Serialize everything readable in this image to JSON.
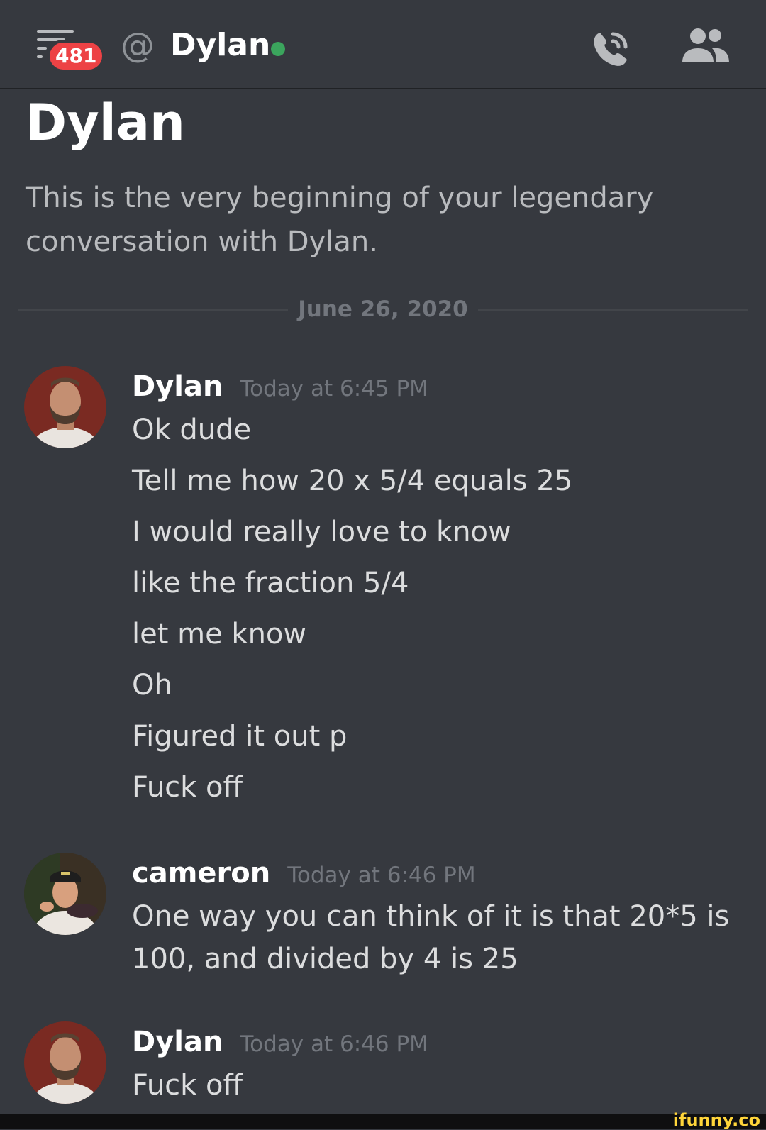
{
  "header": {
    "unread_count": "481",
    "title": "Dylan",
    "menu_icon": "hamburger-icon",
    "at_icon": "at-icon",
    "call_icon": "phone-call-icon",
    "members_icon": "members-icon",
    "status_color": "#3ba55d"
  },
  "welcome": {
    "title": "Dylan",
    "text": "This is the very beginning of your legendary conversation with Dylan."
  },
  "date_divider": "June 26, 2020",
  "messages": [
    {
      "author": "Dylan",
      "timestamp": "Today at 6:45 PM",
      "lines": [
        "Ok dude",
        "Tell me how 20 x 5/4 equals 25",
        "I would really love to know",
        "like the fraction 5/4",
        "let me know",
        "Oh",
        "Figured it out p",
        "Fuck off"
      ]
    },
    {
      "author": "cameron",
      "timestamp": "Today at 6:46 PM",
      "text": "One way you can think of it is that 20*5 is 100, and divided by 4 is 25"
    },
    {
      "author": "Dylan",
      "timestamp": "Today at 6:46 PM",
      "lines": [
        "Fuck off"
      ]
    }
  ],
  "watermark": "ifunny.co",
  "colors": {
    "background": "#36393f",
    "badge": "#ed4245",
    "online": "#3ba55d",
    "muted": "#72767d"
  }
}
